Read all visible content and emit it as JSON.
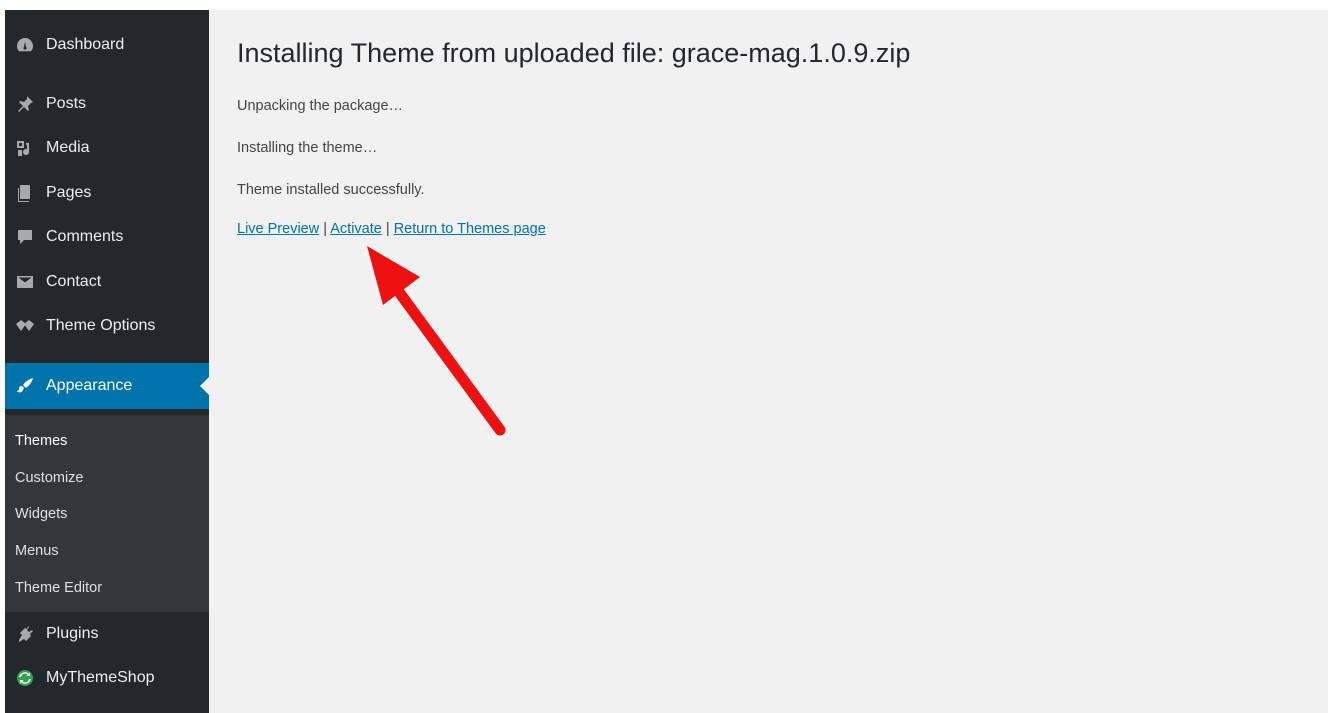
{
  "sidebar": {
    "items": [
      {
        "label": "Dashboard",
        "icon": "dashboard-icon"
      },
      {
        "label": "Posts",
        "icon": "pushpin-icon"
      },
      {
        "label": "Media",
        "icon": "media-icon"
      },
      {
        "label": "Pages",
        "icon": "pages-icon"
      },
      {
        "label": "Comments",
        "icon": "comment-icon"
      },
      {
        "label": "Contact",
        "icon": "envelope-icon"
      },
      {
        "label": "Theme Options",
        "icon": "diamond-icon"
      },
      {
        "label": "Appearance",
        "icon": "paintbrush-icon"
      },
      {
        "label": "Plugins",
        "icon": "plugin-icon"
      },
      {
        "label": "MyThemeShop",
        "icon": "refresh-icon"
      }
    ],
    "current": "Appearance",
    "submenu": [
      "Themes",
      "Customize",
      "Widgets",
      "Menus",
      "Theme Editor"
    ],
    "active_submenu": "Themes"
  },
  "main": {
    "title": "Installing Theme from uploaded file: grace-mag.1.0.9.zip",
    "messages": [
      "Unpacking the package…",
      "Installing the theme…",
      "Theme installed successfully."
    ],
    "actions": {
      "live_preview": "Live Preview",
      "activate": "Activate",
      "return": "Return to Themes page",
      "separator": "|"
    }
  },
  "colors": {
    "sidebar_bg": "#23282d",
    "submenu_bg": "#32373c",
    "current_bg": "#0073aa",
    "link": "#0073aa",
    "main_bg": "#f1f1f1",
    "annotation_arrow": "#ee1111"
  }
}
